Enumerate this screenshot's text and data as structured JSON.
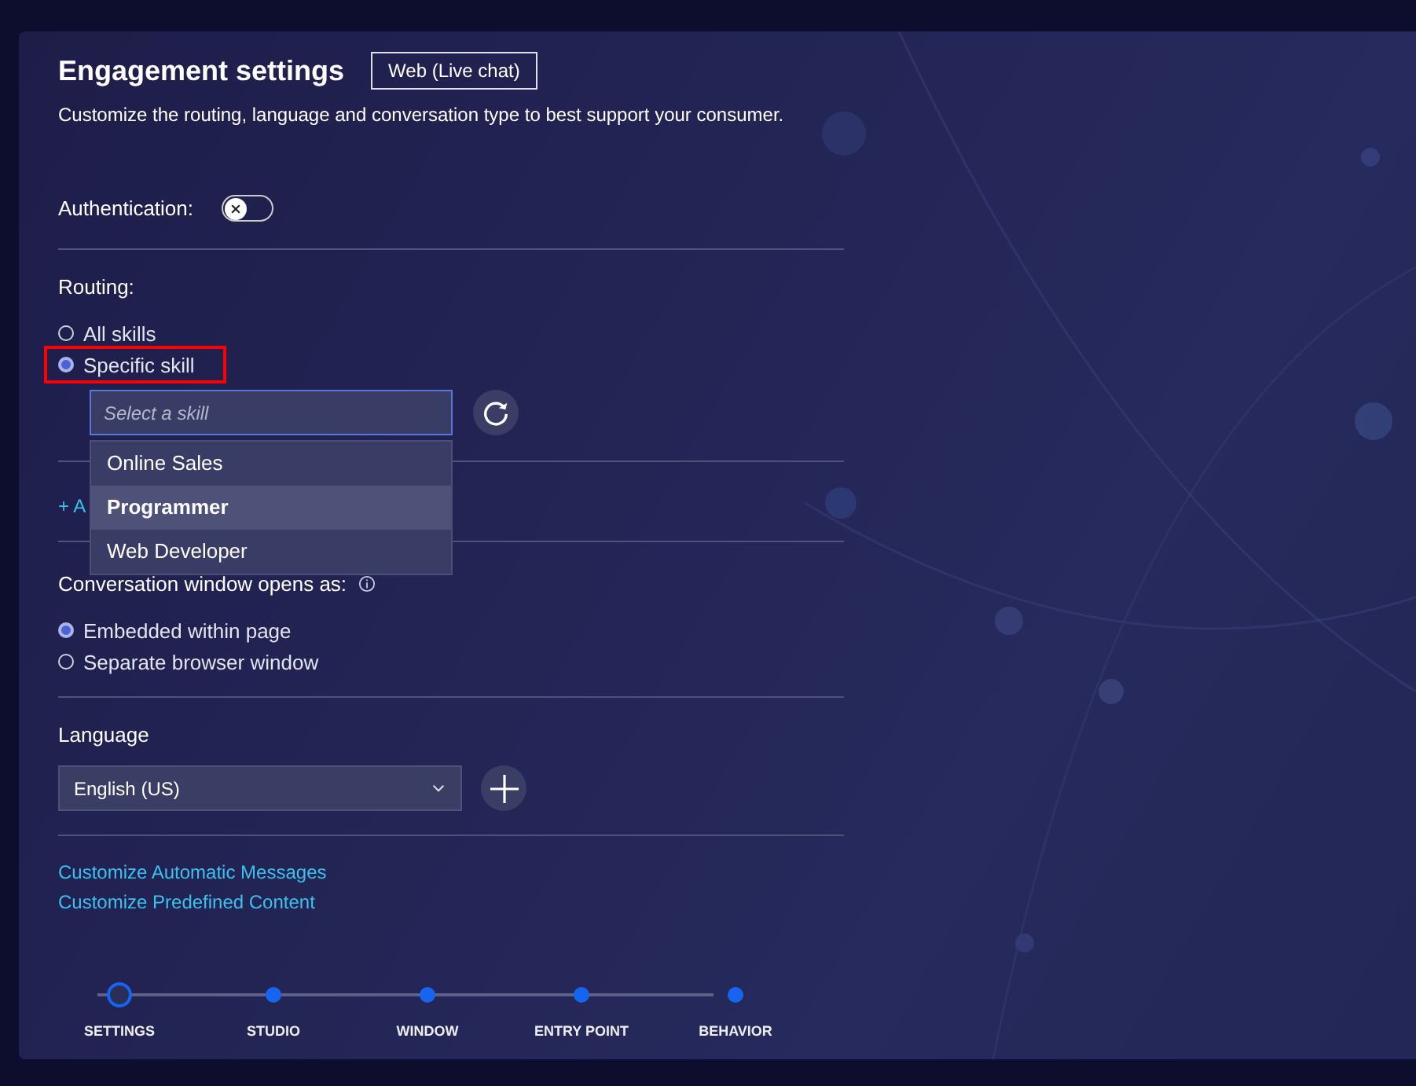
{
  "header": {
    "title": "Engagement settings",
    "channel_badge": "Web (Live chat)",
    "subtitle": "Customize the routing, language and conversation type to best support your consumer."
  },
  "authentication": {
    "label": "Authentication:",
    "on": false
  },
  "routing": {
    "label": "Routing:",
    "options": [
      {
        "label": "All skills",
        "selected": false,
        "highlighted": false
      },
      {
        "label": "Specific skill",
        "selected": true,
        "highlighted": true
      }
    ],
    "skill_field": {
      "placeholder": "Select a skill"
    },
    "skill_menu": [
      {
        "label": "Online Sales",
        "selected": false
      },
      {
        "label": "Programmer",
        "selected": true
      },
      {
        "label": "Web Developer",
        "selected": false
      }
    ],
    "add_link": "+ A"
  },
  "conversation_window": {
    "label": "Conversation window opens as:",
    "options": [
      {
        "label": "Embedded within page",
        "selected": true
      },
      {
        "label": "Separate browser window",
        "selected": false
      }
    ]
  },
  "language": {
    "label": "Language",
    "value": "English (US)"
  },
  "links": [
    "Customize Automatic Messages",
    "Customize Predefined Content"
  ],
  "steps": [
    {
      "label": "SETTINGS",
      "selected": true
    },
    {
      "label": "STUDIO",
      "selected": false
    },
    {
      "label": "WINDOW",
      "selected": false
    },
    {
      "label": "ENTRY POINT",
      "selected": false
    },
    {
      "label": "BEHAVIOR",
      "selected": false
    }
  ]
}
